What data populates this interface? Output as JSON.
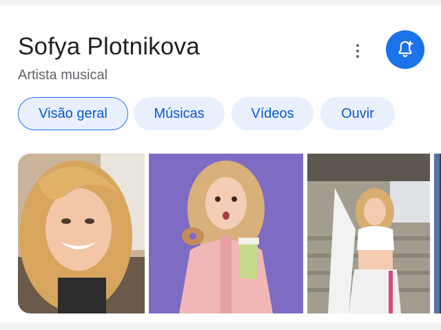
{
  "entity": {
    "name": "Sofya Plotnikova",
    "subtitle": "Artista musical"
  },
  "actions": {
    "more_icon": "more-vert-icon",
    "bell_icon": "bell-plus-icon",
    "accent_color": "#1a73e8"
  },
  "tabs": [
    {
      "label": "Visão geral",
      "active": true
    },
    {
      "label": "Músicas",
      "active": false
    },
    {
      "label": "Vídeos",
      "active": false
    },
    {
      "label": "Ouvir",
      "active": false
    }
  ],
  "gallery": {
    "image_count_visible": 4
  }
}
